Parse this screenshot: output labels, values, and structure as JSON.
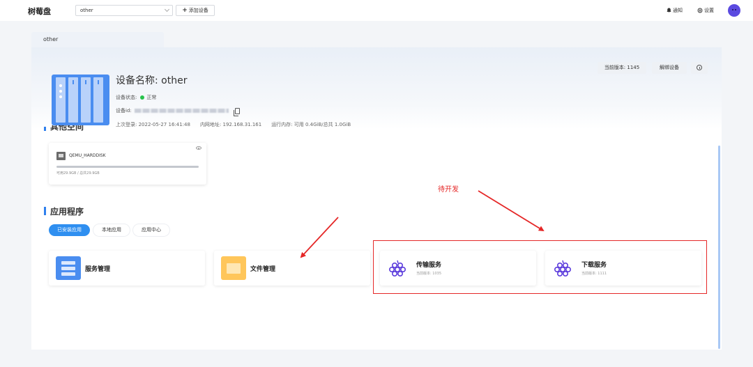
{
  "topbar": {
    "brand": "树莓盘",
    "device_select": "other",
    "add_device": "添加设备",
    "notify": "通知",
    "settings": "设置"
  },
  "tab": {
    "label": "other"
  },
  "device": {
    "name": "设备名称: other",
    "status_label": "设备状态:",
    "status_value": "正常",
    "id_label": "设备id:",
    "last_login": "上次登录: 2022-05-27 16:41:48",
    "ip": "内网地址: 192.168.31.161",
    "memory": "运行内存: 可用 0.4GiB/总共 1.0GiB",
    "version_btn": "当前版本: 1145",
    "unbind_btn": "解绑设备"
  },
  "storage": {
    "heading": "其他空间",
    "disk_name": "QEMU_HARDDISK",
    "usage": "可用29.9GB / 总共29.9GB",
    "used_fraction": 0.0
  },
  "apps": {
    "heading": "应用程序",
    "filters": [
      "已安装应用",
      "本地应用",
      "应用中心"
    ],
    "items": [
      {
        "title": "服务管理",
        "version": ""
      },
      {
        "title": "文件管理",
        "version": ""
      },
      {
        "title": "传输服务",
        "version": "当前版本: 1035"
      },
      {
        "title": "下载服务",
        "version": "当前版本: 1111"
      }
    ]
  },
  "annotation": {
    "text": "待开发",
    "color": "#e52727"
  },
  "colors": {
    "accent": "#2f8ff0",
    "status_ok": "#27c24c",
    "grape": "#5b3bdc"
  }
}
